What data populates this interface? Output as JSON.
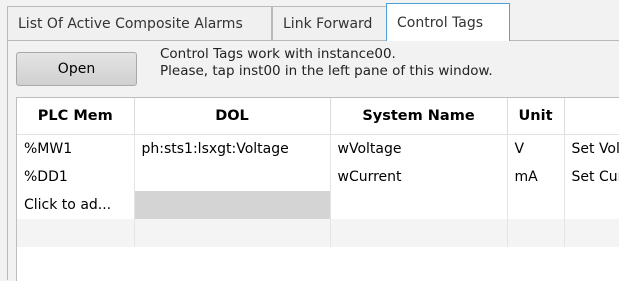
{
  "tabs": [
    {
      "label": "List Of Active Composite Alarms",
      "active": false
    },
    {
      "label": "Link Forward",
      "active": false
    },
    {
      "label": "Control Tags",
      "active": true
    }
  ],
  "toolbar": {
    "open_label": "Open"
  },
  "info": {
    "line1": "Control Tags work with instance00.",
    "line2": "Please, tap inst00 in the left pane of this window."
  },
  "grid": {
    "columns": [
      "PLC Mem",
      "DOL",
      "System Name",
      "Unit",
      ""
    ],
    "rows": [
      {
        "plc": "%MW1",
        "dol": "ph:sts1:lsxgt:Voltage",
        "sys": "wVoltage",
        "unit": "V",
        "extra": "Set Voltage"
      },
      {
        "plc": "%DD1",
        "dol": "",
        "sys": "wCurrent",
        "unit": "mA",
        "extra": "Set Current"
      },
      {
        "plc": "Click to ad...",
        "dol": "",
        "sys": "",
        "unit": "",
        "extra": ""
      },
      {
        "plc": "",
        "dol": "",
        "sys": "",
        "unit": "",
        "extra": ""
      }
    ]
  },
  "colors": {
    "active_tab_border": "#4aa3d8",
    "new_row_dol_fill": "#d4d4d4"
  }
}
